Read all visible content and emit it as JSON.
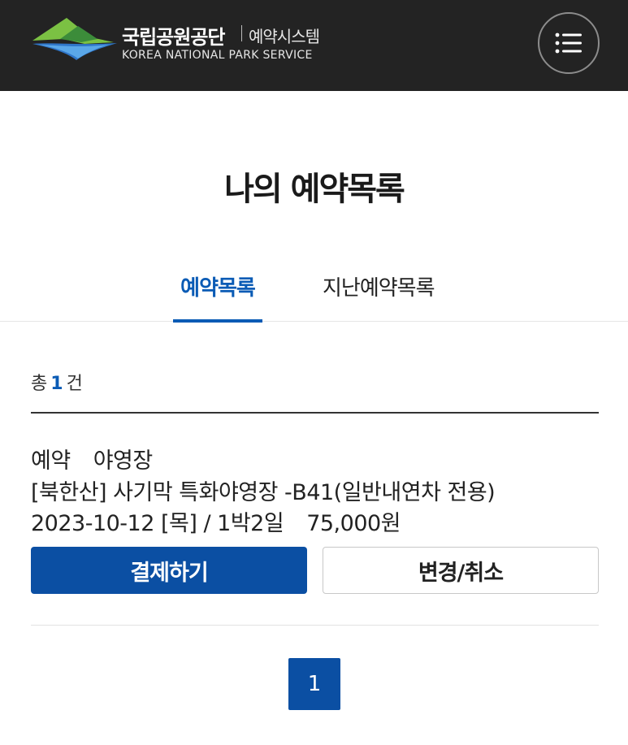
{
  "header": {
    "brand_name": "국립공원공단",
    "system_name": "예약시스템",
    "brand_en": "KOREA NATIONAL PARK SERVICE",
    "logo_icon": "mountain-logo-icon",
    "menu_icon": "list-menu-icon"
  },
  "page": {
    "title": "나의 예약목록"
  },
  "tabs": [
    {
      "label": "예약목록",
      "active": true
    },
    {
      "label": "지난예약목록",
      "active": false
    }
  ],
  "summary": {
    "prefix": "총",
    "count": "1",
    "suffix": "건"
  },
  "reservations": [
    {
      "status": "예약",
      "type": "야영장",
      "site": "[북한산] 사기막 특화야영장 -B41(일반내연차 전용)",
      "schedule": "2023-10-12 [목] / 1박2일",
      "price": "75,000원",
      "pay_label": "결제하기",
      "change_label": "변경/취소"
    }
  ],
  "pagination": {
    "current": "1"
  },
  "colors": {
    "header_bg": "#232323",
    "accent": "#0a5bb5",
    "button_primary": "#0b4fa3"
  }
}
